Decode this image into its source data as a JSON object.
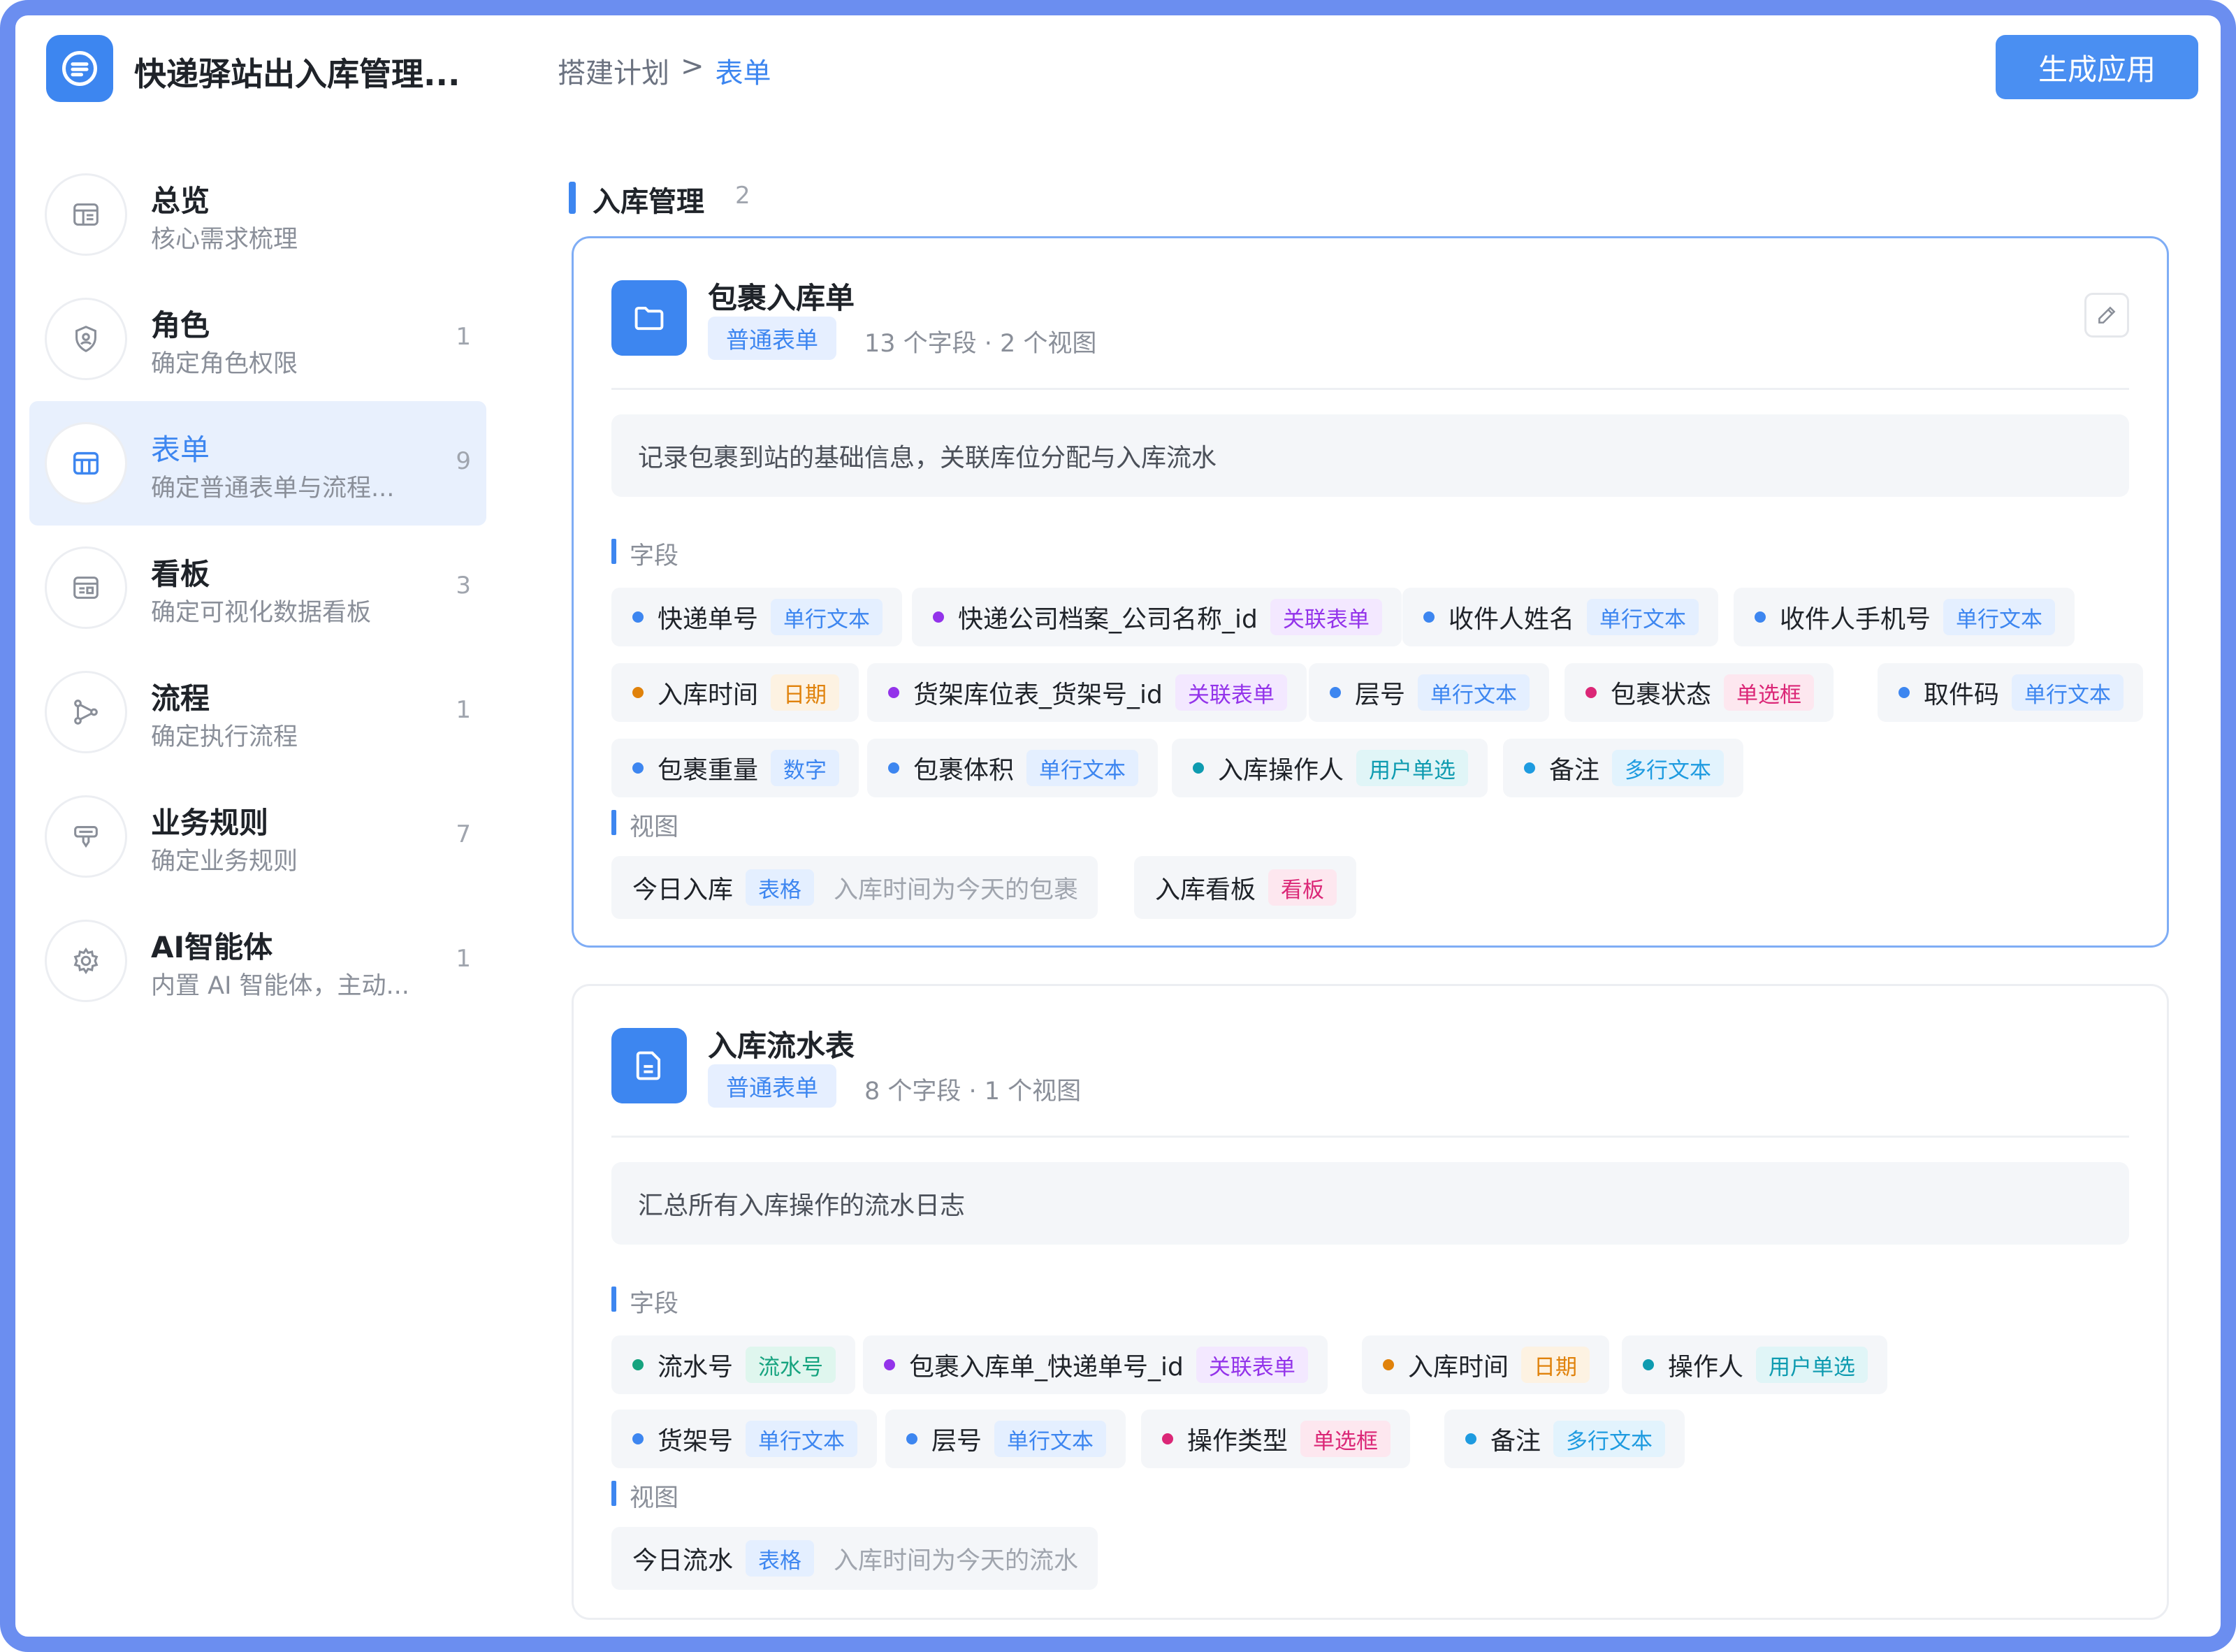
{
  "header": {
    "app_title": "快递驿站出入库管理...",
    "breadcrumb_parent": "搭建计划",
    "breadcrumb_sep": ">",
    "breadcrumb_current": "表单",
    "generate_button": "生成应用"
  },
  "sidebar": {
    "items": [
      {
        "label": "总览",
        "sub": "核心需求梳理",
        "count": "",
        "icon": "overview-icon"
      },
      {
        "label": "角色",
        "sub": "确定角色权限",
        "count": "1",
        "icon": "role-shield-icon"
      },
      {
        "label": "表单",
        "sub": "确定普通表单与流程...",
        "count": "9",
        "icon": "form-table-icon"
      },
      {
        "label": "看板",
        "sub": "确定可视化数据看板",
        "count": "3",
        "icon": "dashboard-icon"
      },
      {
        "label": "流程",
        "sub": "确定执行流程",
        "count": "1",
        "icon": "workflow-icon"
      },
      {
        "label": "业务规则",
        "sub": "确定业务规则",
        "count": "7",
        "icon": "business-rule-icon"
      },
      {
        "label": "AI智能体",
        "sub": "内置 AI 智能体，主动...",
        "count": "1",
        "icon": "ai-agent-icon"
      }
    ]
  },
  "section": {
    "title": "入库管理",
    "count": "2"
  },
  "labels": {
    "fields": "字段",
    "views": "视图"
  },
  "colors": {
    "accent": "#3d86f0",
    "frame": "#6b8ef0",
    "dot_blue": "#3d86f0",
    "dot_purple": "#9333ea",
    "dot_orange": "#e0820b",
    "dot_pink": "#db2777",
    "dot_green": "#16a37f",
    "dot_teal": "#0e9bb0",
    "dot_sky": "#1e9be0"
  },
  "cards": [
    {
      "title": "包裹入库单",
      "type": "普通表单",
      "meta": "13 个字段 · 2 个视图",
      "icon": "folder-icon",
      "description": "记录包裹到站的基础信息，关联库位分配与入库流水",
      "fields": [
        {
          "name": "快递单号",
          "type": "单行文本"
        },
        {
          "name": "快递公司档案_公司名称_id",
          "type": "关联表单"
        },
        {
          "name": "收件人姓名",
          "type": "单行文本"
        },
        {
          "name": "收件人手机号",
          "type": "单行文本"
        },
        {
          "name": "入库时间",
          "type": "日期"
        },
        {
          "name": "货架库位表_货架号_id",
          "type": "关联表单"
        },
        {
          "name": "层号",
          "type": "单行文本"
        },
        {
          "name": "包裹状态",
          "type": "单选框"
        },
        {
          "name": "取件码",
          "type": "单行文本"
        },
        {
          "name": "包裹重量",
          "type": "数字"
        },
        {
          "name": "包裹体积",
          "type": "单行文本"
        },
        {
          "name": "入库操作人",
          "type": "用户单选"
        },
        {
          "name": "备注",
          "type": "多行文本"
        }
      ],
      "views": [
        {
          "name": "今日入库",
          "type": "表格",
          "desc": "入库时间为今天的包裹"
        },
        {
          "name": "入库看板",
          "type": "看板",
          "desc": ""
        }
      ]
    },
    {
      "title": "入库流水表",
      "type": "普通表单",
      "meta": "8 个字段 · 1 个视图",
      "icon": "document-icon",
      "description": "汇总所有入库操作的流水日志",
      "fields": [
        {
          "name": "流水号",
          "type": "流水号"
        },
        {
          "name": "包裹入库单_快递单号_id",
          "type": "关联表单"
        },
        {
          "name": "入库时间",
          "type": "日期"
        },
        {
          "name": "操作人",
          "type": "用户单选"
        },
        {
          "name": "货架号",
          "type": "单行文本"
        },
        {
          "name": "层号",
          "type": "单行文本"
        },
        {
          "name": "操作类型",
          "type": "单选框"
        },
        {
          "name": "备注",
          "type": "多行文本"
        }
      ],
      "views": [
        {
          "name": "今日流水",
          "type": "表格",
          "desc": "入库时间为今天的流水"
        }
      ]
    }
  ]
}
